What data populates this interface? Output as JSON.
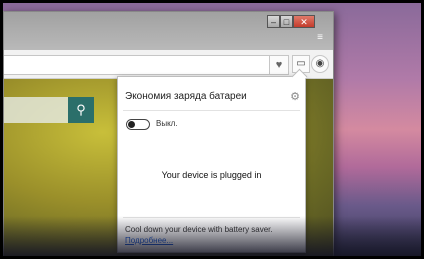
{
  "window": {
    "min_label": "–",
    "max_label": "□",
    "close_label": "✕",
    "menu_icon": "≡"
  },
  "toolbar": {
    "heart_icon": "♥",
    "battery_icon": "▭",
    "account_icon": "◉"
  },
  "search": {
    "button_icon": "⚲"
  },
  "battery_popup": {
    "title": "Экономия заряда батареи",
    "settings_icon": "⚙",
    "toggle_label": "Выкл.",
    "status": "Your device is plugged in",
    "footer_text": "Cool down your device with battery saver.",
    "more_link": "Подробнее..."
  }
}
